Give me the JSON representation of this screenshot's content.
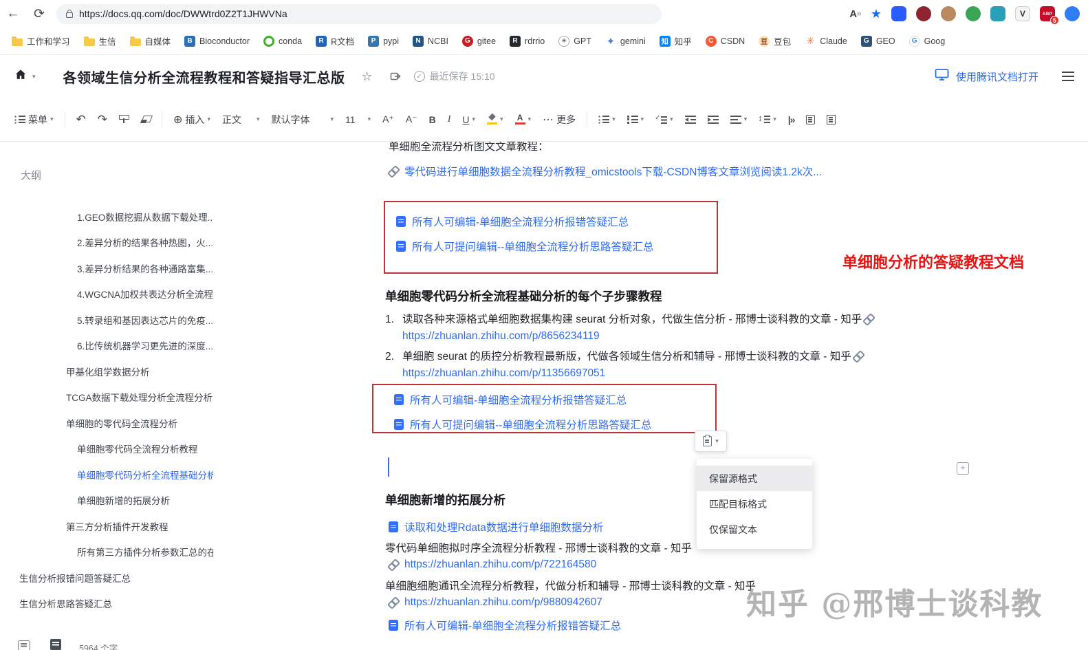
{
  "colors": {
    "link_blue": "#2f6bf0",
    "accent_blue": "#2a6bf2",
    "doc_icon_blue": "#3370ff",
    "red_annotation": "#e81414",
    "red_box_border": "#c23434",
    "folder_yellow": "#f7c948",
    "outline_active": "#2d65f2"
  },
  "browser": {
    "url": "https://docs.qq.com/doc/DWWtrd0Z2T1JHWVNa",
    "extensions": {
      "vimium_label": "V",
      "adblock_label": "ABP",
      "adblock_badge": "5"
    },
    "bookmarks": [
      {
        "label": "工作和学习",
        "fav": ""
      },
      {
        "label": "生信",
        "fav": ""
      },
      {
        "label": "自媒体",
        "fav": ""
      },
      {
        "label": "Bioconductor",
        "fav": "B"
      },
      {
        "label": "conda",
        "fav": ""
      },
      {
        "label": "R文档",
        "fav": "R"
      },
      {
        "label": "pypi",
        "fav": "P"
      },
      {
        "label": "NCBI",
        "fav": "N"
      },
      {
        "label": "gitee",
        "fav": "G"
      },
      {
        "label": "rdrrio",
        "fav": "R"
      },
      {
        "label": "GPT",
        "fav": "✳"
      },
      {
        "label": "gemini",
        "fav": "✦"
      },
      {
        "label": "知乎",
        "fav": "知"
      },
      {
        "label": "CSDN",
        "fav": "C"
      },
      {
        "label": "豆包",
        "fav": "豆"
      },
      {
        "label": "Claude",
        "fav": "✳"
      },
      {
        "label": "GEO",
        "fav": "G"
      },
      {
        "label": "Goog",
        "fav": "G"
      }
    ]
  },
  "doc_header": {
    "title": "各领域生信分析全流程教程和答疑指导汇总版",
    "save_status": "最近保存 15:10",
    "open_app_label": "使用腾讯文档打开"
  },
  "toolbar": {
    "menu": "菜单",
    "insert": "插入",
    "para_style": "正文",
    "font_family": "默认字体",
    "font_size": "11",
    "more": "更多"
  },
  "outline": {
    "title": "大纲",
    "items": [
      {
        "label": "1.GEO数据挖掘从数据下载处理..."
      },
      {
        "label": "2.差异分析的结果各种热图，火..."
      },
      {
        "label": "3.差异分析结果的各种通路富集..."
      },
      {
        "label": "4.WGCNA加权共表达分析全流程..."
      },
      {
        "label": "5.转录组和基因表达芯片的免疫..."
      },
      {
        "label": "6.比传统机器学习更先进的深度..."
      },
      {
        "label": "甲基化组学数据分析"
      },
      {
        "label": "TCGA数据下载处理分析全流程分析"
      },
      {
        "label": "单细胞的零代码全流程分析"
      },
      {
        "label": "单细胞零代码全流程分析教程"
      },
      {
        "label": "单细胞零代码分析全流程基础分析..."
      },
      {
        "label": "单细胞新增的拓展分析"
      },
      {
        "label": "第三方分析插件开发教程"
      },
      {
        "label": "所有第三方插件分析参数汇总的在..."
      },
      {
        "label": "生信分析报错问题答疑汇总"
      },
      {
        "label": "生信分析思路答疑汇总"
      }
    ]
  },
  "doc": {
    "intro_line": "单细胞全流程分析图文文章教程：",
    "csdn_link": "零代码进行单细胞数据全流程分析教程_omicstools下载-CSDN博客文章浏览阅读1.2k次...",
    "qa_links": {
      "edit": "所有人可编辑-单细胞全流程分析报错答疑汇总",
      "ask": "所有人可提问编辑--单细胞全流程分析思路答疑汇总"
    },
    "red_note": "单细胞分析的答疑教程文档",
    "section1_title": "单细胞零代码分析全流程基础分析的每个子步骤教程",
    "steps": [
      {
        "num": "1.",
        "text": "读取各种来源格式单细胞数据集构建 seurat 分析对象，代做生信分析 - 邢博士谈科教的文章 - 知乎",
        "url": "https://zhuanlan.zhihu.com/p/8656234119"
      },
      {
        "num": "2.",
        "text": "单细胞 seurat 的质控分析教程最新版，代做各领域生信分析和辅导 - 邢博士谈科教的文章 - 知乎",
        "url": "https://zhuanlan.zhihu.com/p/11356697051"
      }
    ],
    "section2_title": "单细胞新增的拓展分析",
    "rdata_link": "读取和处理Rdata数据进行单细胞数据分析",
    "pseudotime_text": "零代码单细胞拟时序全流程分析教程 - 邢博士谈科教的文章 - 知乎",
    "pseudotime_url": "https://zhuanlan.zhihu.com/p/722164580",
    "cellchat_text": "单细胞细胞通讯全流程分析教程，代做分析和辅导 - 邢博士谈科教的文章 - 知乎",
    "cellchat_url": "https://zhuanlan.zhihu.com/p/9880942607"
  },
  "paste_menu": {
    "items": [
      "保留源格式",
      "匹配目标格式",
      "仅保留文本"
    ]
  },
  "watermark": "知乎 @邢博士谈科教",
  "status_bar": {
    "word_count": "5964 个字"
  }
}
